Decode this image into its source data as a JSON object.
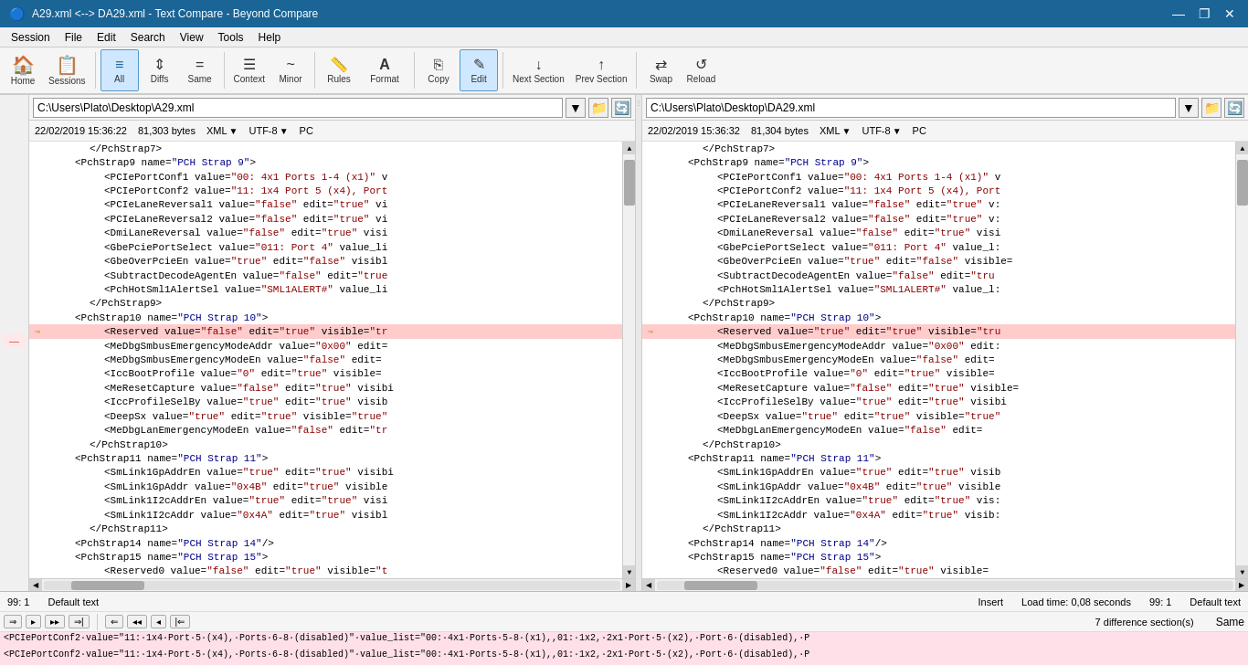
{
  "window": {
    "title": "A29.xml <--> DA29.xml - Text Compare - Beyond Compare",
    "min": "—",
    "max": "❐",
    "close": "✕"
  },
  "menu": {
    "items": [
      "Session",
      "File",
      "Edit",
      "Search",
      "View",
      "Tools",
      "Help"
    ]
  },
  "toolbar": {
    "buttons": [
      {
        "id": "home",
        "label": "Home",
        "icon": "🏠"
      },
      {
        "id": "sessions",
        "label": "Sessions",
        "icon": "📋"
      },
      {
        "id": "all",
        "label": "All",
        "icon": "≡",
        "active": true
      },
      {
        "id": "diffs",
        "label": "Diffs",
        "icon": "⇕"
      },
      {
        "id": "same",
        "label": "Same",
        "icon": "="
      },
      {
        "id": "context",
        "label": "Context",
        "icon": "☰"
      },
      {
        "id": "minor",
        "label": "Minor",
        "icon": "~"
      },
      {
        "id": "rules",
        "label": "Rules",
        "icon": "📏"
      },
      {
        "id": "format",
        "label": "Format",
        "icon": "A"
      },
      {
        "id": "copy",
        "label": "Copy",
        "icon": "⎘"
      },
      {
        "id": "edit",
        "label": "Edit",
        "icon": "✎"
      },
      {
        "id": "next-section",
        "label": "Next Section",
        "icon": "↓"
      },
      {
        "id": "prev-section",
        "label": "Prev Section",
        "icon": "↑"
      },
      {
        "id": "swap",
        "label": "Swap",
        "icon": "⇄"
      },
      {
        "id": "reload",
        "label": "Reload",
        "icon": "↺"
      }
    ]
  },
  "left_pane": {
    "path": "C:\\Users\\Plato\\Desktop\\A29.xml",
    "date": "22/02/2019 15:36:22",
    "size": "81,303 bytes",
    "format": "XML",
    "encoding": "UTF-8",
    "line_ending": "PC",
    "lines": [
      {
        "indent": 6,
        "text": "</PchStrap7>",
        "type": "normal"
      },
      {
        "indent": 4,
        "text": "<PchStrap9 name=\"PCH Strap 9\">",
        "type": "normal"
      },
      {
        "indent": 8,
        "text": "<PCIePortConf1 value=\"00: 4x1 Ports 1-4 (x1)\" v",
        "type": "normal"
      },
      {
        "indent": 8,
        "text": "<PCIePortConf2 value=\"11: 1x4 Port 5 (x4), Port",
        "type": "normal"
      },
      {
        "indent": 8,
        "text": "<PCIeLaneReversal1 value=\"false\" edit=\"true\" vi",
        "type": "normal"
      },
      {
        "indent": 8,
        "text": "<PCIeLaneReversal2 value=\"false\" edit=\"true\" vi",
        "type": "normal"
      },
      {
        "indent": 8,
        "text": "<DmiLaneReversal value=\"false\" edit=\"true\" visi",
        "type": "normal"
      },
      {
        "indent": 8,
        "text": "<GbePciePortSelect value=\"011: Port 4\" value_li",
        "type": "normal"
      },
      {
        "indent": 8,
        "text": "<GbeOverPcieEn value=\"true\" edit=\"false\" visibl",
        "type": "normal"
      },
      {
        "indent": 8,
        "text": "<SubtractDecodeAgentEn value=\"false\" edit=\"true",
        "type": "normal"
      },
      {
        "indent": 8,
        "text": "<PchHotSml1AlertSel value=\"SML1ALERT#\" value_li",
        "type": "normal"
      },
      {
        "indent": 6,
        "text": "</PchStrap9>",
        "type": "normal"
      },
      {
        "indent": 4,
        "text": "<PchStrap10 name=\"PCH Strap 10\">",
        "type": "normal"
      },
      {
        "indent": 8,
        "text": "<Reserved value=\"false\" edit=\"true\" visible=\"tr",
        "type": "diff"
      },
      {
        "indent": 8,
        "text": "<MeDbgSmbusEmergencyModeAddr value=\"0x00\" edit=",
        "type": "normal"
      },
      {
        "indent": 8,
        "text": "<MeDbgSmbusEmergencyModeEn value=\"false\" edit=",
        "type": "normal"
      },
      {
        "indent": 8,
        "text": "<IccBootProfile value=\"0\" edit=\"true\" visible=",
        "type": "normal"
      },
      {
        "indent": 8,
        "text": "<MeResetCapture value=\"false\" edit=\"true\" visibi",
        "type": "normal"
      },
      {
        "indent": 8,
        "text": "<IccProfileSelBy value=\"true\" edit=\"true\" visib",
        "type": "normal"
      },
      {
        "indent": 8,
        "text": "<DeepSx value=\"true\" edit=\"true\" visible=\"true\"",
        "type": "normal"
      },
      {
        "indent": 8,
        "text": "<MeDbgLanEmergencyModeEn value=\"false\" edit=\"tr",
        "type": "normal"
      },
      {
        "indent": 6,
        "text": "</PchStrap10>",
        "type": "normal"
      },
      {
        "indent": 4,
        "text": "<PchStrap11 name=\"PCH Strap 11\">",
        "type": "normal"
      },
      {
        "indent": 8,
        "text": "<SmLink1GpAddrEn value=\"true\" edit=\"true\" visibi",
        "type": "normal"
      },
      {
        "indent": 8,
        "text": "<SmLink1GpAddr value=\"0x4B\" edit=\"true\" visible",
        "type": "normal"
      },
      {
        "indent": 8,
        "text": "<SmLink1I2cAddrEn value=\"true\" edit=\"true\" visi",
        "type": "normal"
      },
      {
        "indent": 8,
        "text": "<SmLink1I2cAddr value=\"0x4A\" edit=\"true\" visibl",
        "type": "normal"
      },
      {
        "indent": 6,
        "text": "</PchStrap11>",
        "type": "normal"
      },
      {
        "indent": 4,
        "text": "<PchStrap14 name=\"PCH Strap 14\"/>",
        "type": "normal"
      },
      {
        "indent": 4,
        "text": "<PchStrap15 name=\"PCH Strap 15\">",
        "type": "normal"
      },
      {
        "indent": 8,
        "text": "<Reserved0 value=\"false\" edit=\"true\" visible=\"t",
        "type": "normal"
      }
    ]
  },
  "right_pane": {
    "path": "C:\\Users\\Plato\\Desktop\\DA29.xml",
    "date": "22/02/2019 15:36:32",
    "size": "81,304 bytes",
    "format": "XML",
    "encoding": "UTF-8",
    "line_ending": "PC",
    "lines": [
      {
        "indent": 6,
        "text": "</PchStrap7>",
        "type": "normal"
      },
      {
        "indent": 4,
        "text": "<PchStrap9 name=\"PCH Strap 9\">",
        "type": "normal"
      },
      {
        "indent": 8,
        "text": "<PCIePortConf1 value=\"00: 4x1 Ports 1-4 (x1)\" v",
        "type": "normal"
      },
      {
        "indent": 8,
        "text": "<PCIePortConf2 value=\"11: 1x4 Port 5 (x4), Port",
        "type": "normal"
      },
      {
        "indent": 8,
        "text": "<PCIeLaneReversal1 value=\"false\" edit=\"true\" v:",
        "type": "normal"
      },
      {
        "indent": 8,
        "text": "<PCIeLaneReversal2 value=\"false\" edit=\"true\" v:",
        "type": "normal"
      },
      {
        "indent": 8,
        "text": "<DmiLaneReversal value=\"false\" edit=\"true\" visi",
        "type": "normal"
      },
      {
        "indent": 8,
        "text": "<GbePciePortSelect value=\"011: Port 4\" value_l:",
        "type": "normal"
      },
      {
        "indent": 8,
        "text": "<GbeOverPcieEn value=\"true\" edit=\"false\" visible=",
        "type": "normal"
      },
      {
        "indent": 8,
        "text": "<SubtractDecodeAgentEn value=\"false\" edit=\"tru",
        "type": "normal"
      },
      {
        "indent": 8,
        "text": "<PchHotSml1AlertSel value=\"SML1ALERT#\" value_l:",
        "type": "normal"
      },
      {
        "indent": 6,
        "text": "</PchStrap9>",
        "type": "normal"
      },
      {
        "indent": 4,
        "text": "<PchStrap10 name=\"PCH Strap 10\">",
        "type": "normal"
      },
      {
        "indent": 8,
        "text": "<Reserved value=\"true\" edit=\"true\" visible=\"tru",
        "type": "diff"
      },
      {
        "indent": 8,
        "text": "<MeDbgSmbusEmergencyModeAddr value=\"0x00\" edit:",
        "type": "normal"
      },
      {
        "indent": 8,
        "text": "<MeDbgSmbusEmergencyModeEn value=\"false\" edit=",
        "type": "normal"
      },
      {
        "indent": 8,
        "text": "<IccBootProfile value=\"0\" edit=\"true\" visible=",
        "type": "normal"
      },
      {
        "indent": 8,
        "text": "<MeResetCapture value=\"false\" edit=\"true\" visible=",
        "type": "normal"
      },
      {
        "indent": 8,
        "text": "<IccProfileSelBy value=\"true\" edit=\"true\" visibi",
        "type": "normal"
      },
      {
        "indent": 8,
        "text": "<DeepSx value=\"true\" edit=\"true\" visible=\"true\"",
        "type": "normal"
      },
      {
        "indent": 8,
        "text": "<MeDbgLanEmergencyModeEn value=\"false\" edit=",
        "type": "normal"
      },
      {
        "indent": 6,
        "text": "</PchStrap10>",
        "type": "normal"
      },
      {
        "indent": 4,
        "text": "<PchStrap11 name=\"PCH Strap 11\">",
        "type": "normal"
      },
      {
        "indent": 8,
        "text": "<SmLink1GpAddrEn value=\"true\" edit=\"true\" visib",
        "type": "normal"
      },
      {
        "indent": 8,
        "text": "<SmLink1GpAddr value=\"0x4B\" edit=\"true\" visible",
        "type": "normal"
      },
      {
        "indent": 8,
        "text": "<SmLink1I2cAddrEn value=\"true\" edit=\"true\" vis:",
        "type": "normal"
      },
      {
        "indent": 8,
        "text": "<SmLink1I2cAddr value=\"0x4A\" edit=\"true\" visib:",
        "type": "normal"
      },
      {
        "indent": 6,
        "text": "</PchStrap11>",
        "type": "normal"
      },
      {
        "indent": 4,
        "text": "<PchStrap14 name=\"PCH Strap 14\"/>",
        "type": "normal"
      },
      {
        "indent": 4,
        "text": "<PchStrap15 name=\"PCH Strap 15\">",
        "type": "normal"
      },
      {
        "indent": 8,
        "text": "<Reserved0 value=\"false\" edit=\"true\" visible=",
        "type": "normal"
      }
    ]
  },
  "status": {
    "left_pos": "99: 1",
    "left_text": "Default text",
    "right_pos": "99: 1",
    "right_text": "Default text",
    "insert": "Insert",
    "load_time": "Load time: 0,08 seconds",
    "diff_count": "7 difference section(s)",
    "same": "Same"
  },
  "bottom_diff_rows": [
    "<PCIePortConf2·value=\"11:·1x4·Port·5·(x4),·Ports·6-8·(disabled)\"·value_list=\"00:·4x1·Ports·5-8·(x1),,01:·1x2,·2x1·Port·5·(x2),·Port·6·(disabled),·P",
    "<PCIePortConf2·value=\"11:·1x4·Port·5·(x4),·Ports·6-8·(disabled)\"·value_list=\"00:·4x1·Ports·5-8·(x1),,01:·1x2,·2x1·Port·5·(x2),·Port·6·(disabled),·P"
  ]
}
